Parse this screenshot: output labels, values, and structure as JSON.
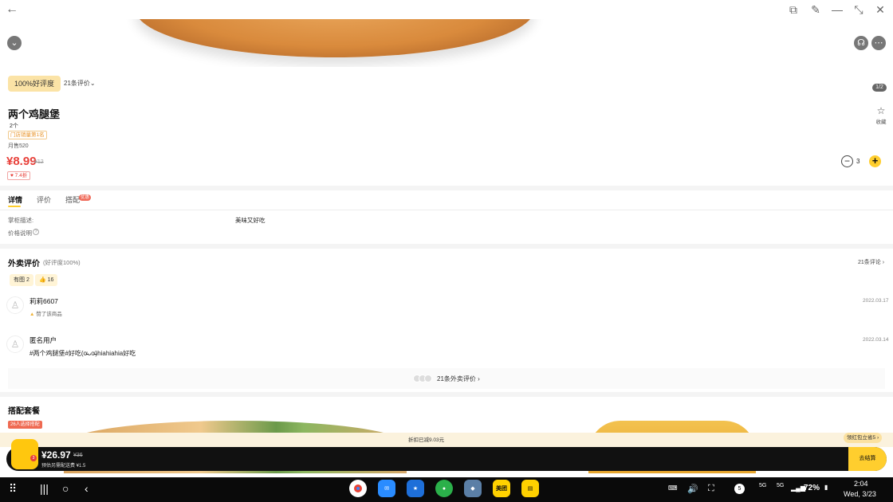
{
  "window": {
    "back_icon": "arrow-left-icon",
    "actions": [
      "popup-icon",
      "pin-icon",
      "minimize-icon",
      "shrink-icon",
      "close-icon"
    ]
  },
  "product": {
    "rating_badge": "100%好评度",
    "reviews_link": "21条评价",
    "image_indicator": "1/2",
    "name": "两个鸡腿堡",
    "quantity": "2个",
    "rank_badge": "门店销量第1名",
    "monthly_sales": "月售520",
    "price": "¥8.99",
    "original_price": "¥12",
    "discount": "7.4折",
    "favorite_label": "收藏",
    "cart_count": "3"
  },
  "tabs": [
    {
      "label": "详情"
    },
    {
      "label": "评价"
    },
    {
      "label": "搭配",
      "badge": "优惠"
    }
  ],
  "details": {
    "desc_label": "掌柜描述:",
    "desc_value": "美味又好吃",
    "price_note_label": "价格说明"
  },
  "reviews": {
    "title": "外卖评价",
    "subtitle": "(好评度100%)",
    "all_link": "21条评论",
    "filters": [
      {
        "label": "有图 2"
      },
      {
        "label": "👍 16"
      }
    ],
    "items": [
      {
        "user": "莉莉6607",
        "date": "2022.03.17",
        "note": "赞了该商品",
        "text": ""
      },
      {
        "user": "匿名用户",
        "date": "2022.03.14",
        "note": "",
        "text": "#两个鸡腿堡#好吃(ơ̴̴̴̴ᴗơ̴̴̴̴)hiahiahia好吃"
      }
    ],
    "more": "21条外卖评价"
  },
  "combos": {
    "title": "搭配套餐",
    "tag": "26人选择搭配"
  },
  "cart": {
    "promo": "折扣已减9.03元",
    "promo_button": "领红包立省5",
    "total": "¥26.97",
    "total_original": "¥36",
    "delivery": "预估另需配送费 ¥1.5",
    "badge_count": "3",
    "checkout": "去结算"
  },
  "system": {
    "apps": [
      "chrome-icon",
      "mail-icon",
      "star-app-icon",
      "wechat-icon",
      "bird-app-icon",
      "meituan-icon",
      "note-app-icon"
    ],
    "meituan_label": "美团",
    "notification_count": "5",
    "battery": "72%",
    "time": "2:04",
    "date": "Wed, 3/23",
    "net1": "5G",
    "net2": "5G"
  },
  "colors": {
    "accent": "#ffce2e",
    "price_red": "#e8403a",
    "rating_bg": "#fbe3a6"
  }
}
